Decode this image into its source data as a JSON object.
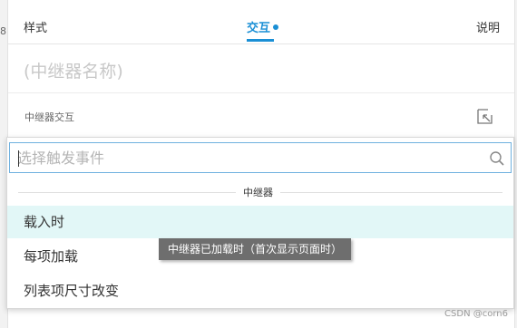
{
  "tabs": {
    "style_label": "样式",
    "interaction_label": "交互",
    "description_label": "说明"
  },
  "left_stub": "8",
  "name_placeholder": "(中继器名称)",
  "section": {
    "label": "中继器交互"
  },
  "search": {
    "placeholder": "选择触发事件",
    "value": ""
  },
  "group": {
    "label": "中继器",
    "items": [
      {
        "label": "载入时"
      },
      {
        "label": "每项加载"
      },
      {
        "label": "列表项尺寸改变"
      }
    ]
  },
  "tooltip": "中继器已加载时（首次显示页面时）",
  "watermark": "CSDN @corn6",
  "colors": {
    "accent": "#1a8fd5",
    "hover": "#e2f7f7",
    "tooltip_bg": "#6e6e6e"
  },
  "icons": {
    "search": "search-icon",
    "corner": "collapse-arrow-icon"
  }
}
